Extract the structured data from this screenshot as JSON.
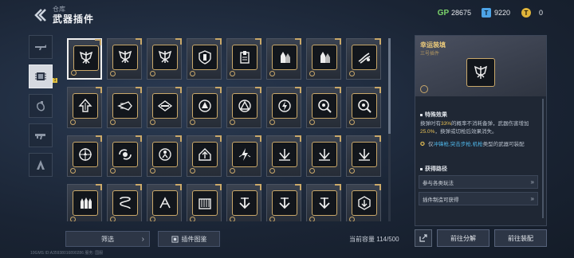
{
  "header": {
    "breadcrumb": "仓库",
    "title": "武器插件"
  },
  "currencies": [
    {
      "icon": "gp-icon",
      "value": "28675"
    },
    {
      "icon": "tp-icon",
      "value": "9220"
    },
    {
      "icon": "ticket-icon",
      "value": "0"
    }
  ],
  "left_tabs": [
    {
      "icon": "rifle-icon",
      "active": false
    },
    {
      "icon": "chip-icon",
      "active": true,
      "badge": "1"
    },
    {
      "icon": "grenade-icon",
      "active": false
    },
    {
      "icon": "assault-rifle-icon",
      "active": false
    },
    {
      "icon": "character-icon",
      "active": false
    }
  ],
  "grid": {
    "rows": [
      [
        "wings-chevron-icon",
        "wings-chevron-icon",
        "wings-chevron-icon",
        "shield-bullet-icon",
        "magazine-icon",
        "bullets-icon",
        "bullets-icon",
        "flame-swirl-icon"
      ],
      [
        "arrow-up-icon",
        "jet-icon",
        "cap-icon",
        "target-triangle-icon",
        "triangle-ring-icon",
        "lightning-ring-icon",
        "magnifier-icon",
        "magnifier-icon"
      ],
      [
        "crosshair-icon",
        "burst-swirl-icon",
        "person-target-icon",
        "house-up-icon",
        "lightning-wings-icon",
        "wing-down-icon",
        "wing-down-icon",
        "wing-down-icon"
      ],
      [
        "bullets-bars-icon",
        "spring-icon",
        "grip-icon",
        "ammo-box-icon",
        "arrow-down-icon",
        "arrow-down-icon",
        "arrow-down-icon",
        "hex-arrow-icon"
      ]
    ],
    "selected": [
      0,
      0
    ]
  },
  "bottom": {
    "filter_label": "筛选",
    "codex_label": "插件图鉴",
    "capacity_label": "当前容量 114/500",
    "footer_id": "10GMS  ID:A35938016890286   服务: 国服"
  },
  "panel": {
    "name": "幸运装填",
    "type": "三号插件",
    "effect_title": "特殊效果",
    "effect_desc_parts": [
      "换弹时有",
      "33%",
      "的概率不消耗备弹，武器伤害增加",
      "25.0%",
      "，换弹或切枪后效果消失。"
    ],
    "note_parts": [
      "仅",
      "冲锋枪,突击步枪,机枪",
      "类型的武器可装配"
    ],
    "route_title": "获得路径",
    "routes": [
      "参与各类玩法",
      "插件制造可获得"
    ]
  },
  "actions": {
    "decompose_label": "前往分解",
    "equip_label": "前往装配"
  },
  "colors": {
    "gold": "#c9a86a",
    "highlight": "#e9c256",
    "blue": "#4fb6e8",
    "bg": "#1b2636"
  }
}
